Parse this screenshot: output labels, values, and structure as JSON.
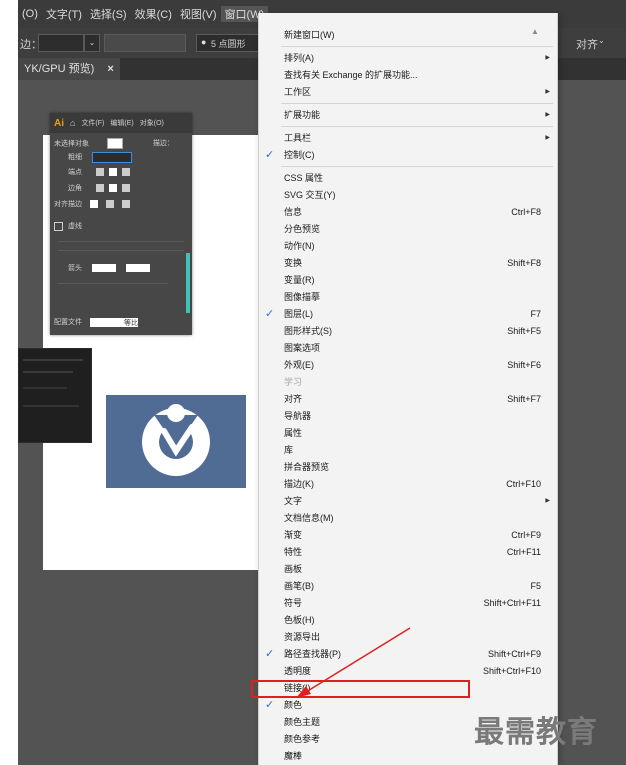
{
  "menubar": [
    "(O)",
    "文字(T)",
    "选择(S)",
    "效果(C)",
    "视图(V)",
    "窗口(W)"
  ],
  "control_bar": {
    "left_label": "边：",
    "point_style": "5 点圆形",
    "right_label": "对齐"
  },
  "doc_tab": {
    "label": "YK/GPU 预览)",
    "close": "×"
  },
  "stroke_panel": {
    "app_logo": "Ai",
    "menu": [
      "文件(F)",
      "编辑(E)",
      "对象(O)"
    ],
    "no_selection": "未选择对象",
    "stroke_label": "描边：",
    "weight_label": "粗细",
    "cap_label": "端点",
    "corner_label": "边角",
    "align_label": "对齐描边",
    "dashed_label": "虚线",
    "arrow_label": "箭头",
    "profile_label": "配置文件",
    "profile_value": "等比"
  },
  "menu": {
    "items": [
      {
        "label": "新建窗口(W)",
        "shortcut": "",
        "arrow": false,
        "check": false,
        "disabled": false
      },
      {
        "sep": true
      },
      {
        "label": "排列(A)",
        "shortcut": "",
        "arrow": true,
        "check": false,
        "disabled": false
      },
      {
        "label": "查找有关 Exchange 的扩展功能...",
        "shortcut": "",
        "arrow": false,
        "check": false,
        "disabled": false
      },
      {
        "label": "工作区",
        "shortcut": "",
        "arrow": true,
        "check": false,
        "disabled": false
      },
      {
        "sep": true
      },
      {
        "label": "扩展功能",
        "shortcut": "",
        "arrow": true,
        "check": false,
        "disabled": false
      },
      {
        "sep": true
      },
      {
        "label": "工具栏",
        "shortcut": "",
        "arrow": true,
        "check": false,
        "disabled": false
      },
      {
        "label": "控制(C)",
        "shortcut": "",
        "arrow": false,
        "check": true,
        "disabled": false
      },
      {
        "sep": true
      },
      {
        "label": "CSS 属性",
        "shortcut": "",
        "arrow": false,
        "check": false,
        "disabled": false
      },
      {
        "label": "SVG 交互(Y)",
        "shortcut": "",
        "arrow": false,
        "check": false,
        "disabled": false
      },
      {
        "label": "信息",
        "shortcut": "Ctrl+F8",
        "arrow": false,
        "check": false,
        "disabled": false
      },
      {
        "label": "分色预览",
        "shortcut": "",
        "arrow": false,
        "check": false,
        "disabled": false
      },
      {
        "label": "动作(N)",
        "shortcut": "",
        "arrow": false,
        "check": false,
        "disabled": false
      },
      {
        "label": "变换",
        "shortcut": "Shift+F8",
        "arrow": false,
        "check": false,
        "disabled": false
      },
      {
        "label": "变量(R)",
        "shortcut": "",
        "arrow": false,
        "check": false,
        "disabled": false
      },
      {
        "label": "图像描摹",
        "shortcut": "",
        "arrow": false,
        "check": false,
        "disabled": false
      },
      {
        "label": "图层(L)",
        "shortcut": "F7",
        "arrow": false,
        "check": true,
        "disabled": false
      },
      {
        "label": "图形样式(S)",
        "shortcut": "Shift+F5",
        "arrow": false,
        "check": false,
        "disabled": false
      },
      {
        "label": "图案选项",
        "shortcut": "",
        "arrow": false,
        "check": false,
        "disabled": false
      },
      {
        "label": "外观(E)",
        "shortcut": "Shift+F6",
        "arrow": false,
        "check": false,
        "disabled": false
      },
      {
        "label": "学习",
        "shortcut": "",
        "arrow": false,
        "check": false,
        "disabled": true
      },
      {
        "label": "对齐",
        "shortcut": "Shift+F7",
        "arrow": false,
        "check": false,
        "disabled": false
      },
      {
        "label": "导航器",
        "shortcut": "",
        "arrow": false,
        "check": false,
        "disabled": false
      },
      {
        "label": "属性",
        "shortcut": "",
        "arrow": false,
        "check": false,
        "disabled": false
      },
      {
        "label": "库",
        "shortcut": "",
        "arrow": false,
        "check": false,
        "disabled": false
      },
      {
        "label": "拼合器预览",
        "shortcut": "",
        "arrow": false,
        "check": false,
        "disabled": false
      },
      {
        "label": "描边(K)",
        "shortcut": "Ctrl+F10",
        "arrow": false,
        "check": false,
        "disabled": false
      },
      {
        "label": "文字",
        "shortcut": "",
        "arrow": true,
        "check": false,
        "disabled": false
      },
      {
        "label": "文档信息(M)",
        "shortcut": "",
        "arrow": false,
        "check": false,
        "disabled": false
      },
      {
        "label": "渐变",
        "shortcut": "Ctrl+F9",
        "arrow": false,
        "check": false,
        "disabled": false
      },
      {
        "label": "特性",
        "shortcut": "Ctrl+F11",
        "arrow": false,
        "check": false,
        "disabled": false
      },
      {
        "label": "画板",
        "shortcut": "",
        "arrow": false,
        "check": false,
        "disabled": false
      },
      {
        "label": "画笔(B)",
        "shortcut": "F5",
        "arrow": false,
        "check": false,
        "disabled": false
      },
      {
        "label": "符号",
        "shortcut": "Shift+Ctrl+F11",
        "arrow": false,
        "check": false,
        "disabled": false
      },
      {
        "label": "色板(H)",
        "shortcut": "",
        "arrow": false,
        "check": false,
        "disabled": false
      },
      {
        "label": "资源导出",
        "shortcut": "",
        "arrow": false,
        "check": false,
        "disabled": false
      },
      {
        "label": "路径查找器(P)",
        "shortcut": "Shift+Ctrl+F9",
        "arrow": false,
        "check": true,
        "disabled": false
      },
      {
        "label": "透明度",
        "shortcut": "Shift+Ctrl+F10",
        "arrow": false,
        "check": false,
        "disabled": false
      },
      {
        "label": "链接(I)",
        "shortcut": "",
        "arrow": false,
        "check": false,
        "disabled": false,
        "highlight": true
      },
      {
        "label": "颜色",
        "shortcut": "",
        "arrow": false,
        "check": true,
        "disabled": false
      },
      {
        "label": "颜色主题",
        "shortcut": "",
        "arrow": false,
        "check": false,
        "disabled": false
      },
      {
        "label": "颜色参考",
        "shortcut": "",
        "arrow": false,
        "check": false,
        "disabled": false
      },
      {
        "label": "魔棒",
        "shortcut": "",
        "arrow": false,
        "check": false,
        "disabled": false
      }
    ]
  },
  "watermark": "最需教育",
  "colors": {
    "accent": "#2f6ed6",
    "highlight_box": "#e02020",
    "annotation_arrow": "#e02020",
    "logo_bg": "#506b94"
  }
}
